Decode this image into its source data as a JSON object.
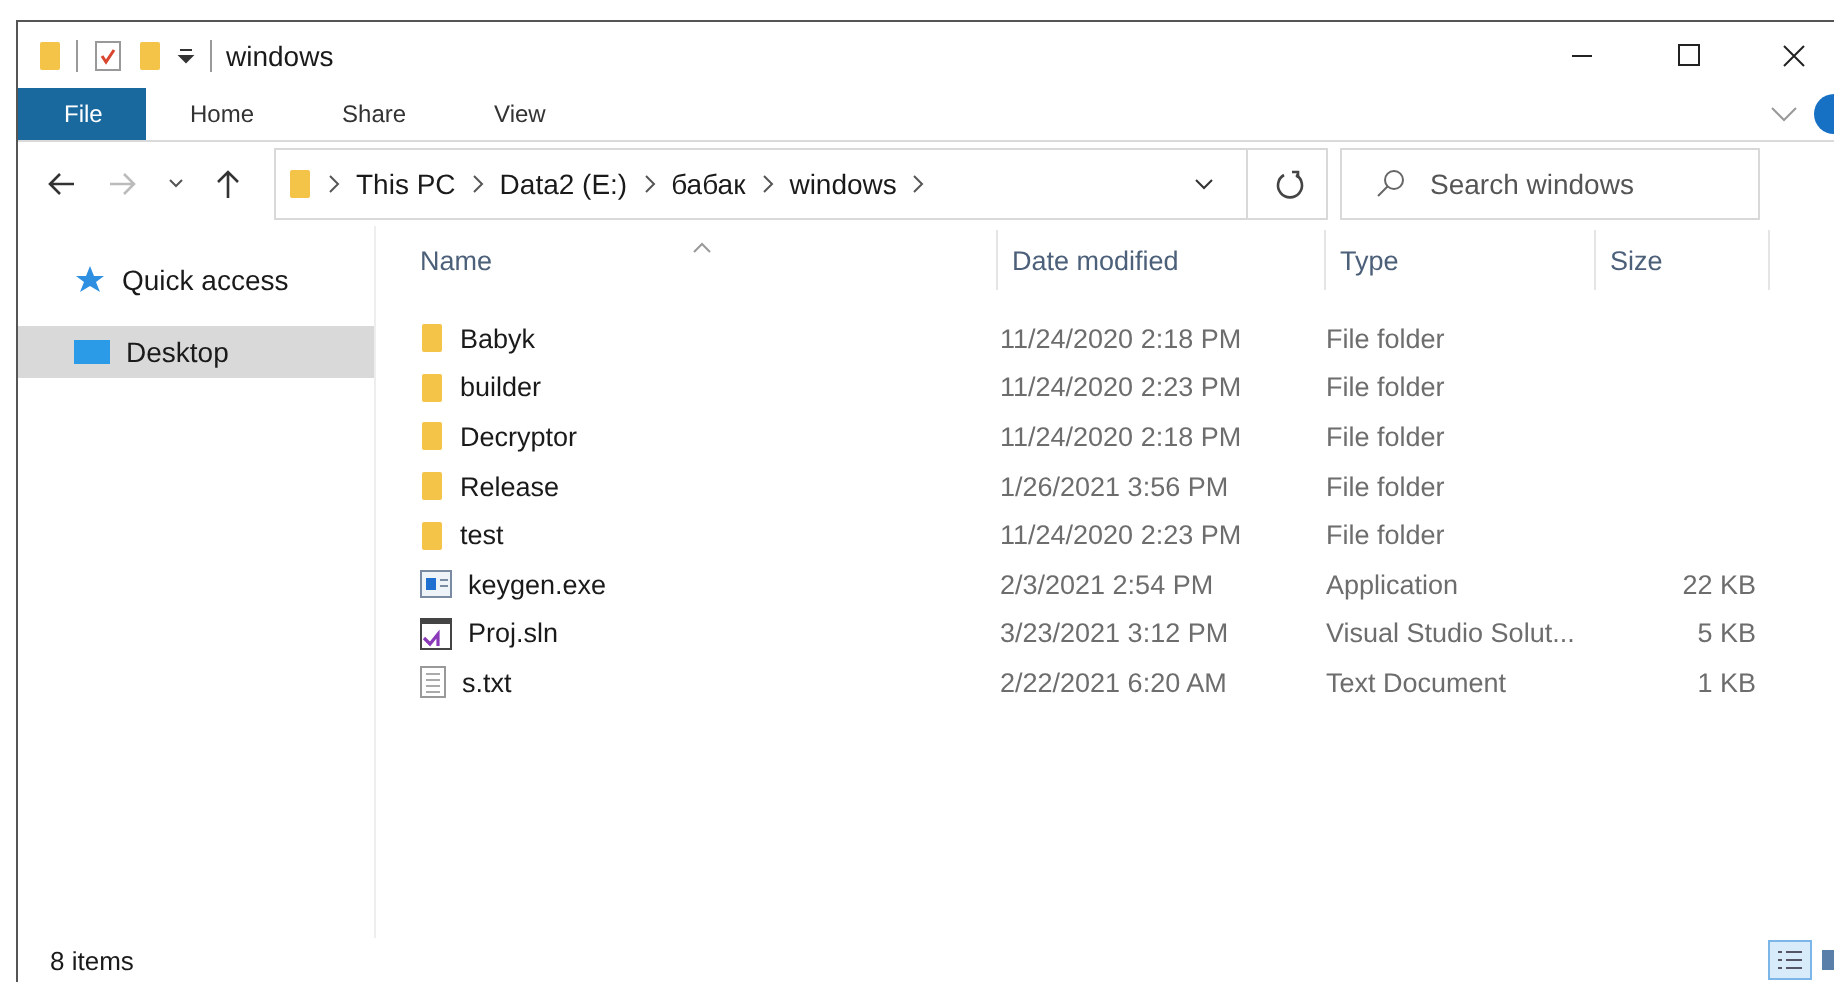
{
  "window": {
    "title": "windows"
  },
  "ribbon_tabs": [
    {
      "label": "File",
      "kind": "backstage",
      "selected": false
    },
    {
      "label": "Home",
      "kind": "tab",
      "selected": false
    },
    {
      "label": "Share",
      "kind": "tab",
      "selected": false
    },
    {
      "label": "View",
      "kind": "tab",
      "selected": false
    }
  ],
  "breadcrumb": [
    "This PC",
    "Data2 (E:)",
    "бабак",
    "windows"
  ],
  "search": {
    "placeholder": "Search windows"
  },
  "sidebar": {
    "items": [
      {
        "label": "Quick access",
        "kind": "star",
        "selected": false
      },
      {
        "label": "Desktop",
        "kind": "desktop",
        "selected": true
      }
    ]
  },
  "table": {
    "columns": [
      "Name",
      "Date modified",
      "Type",
      "Size"
    ],
    "rows": [
      {
        "name": "Babyk",
        "date": "11/24/2020 2:18 PM",
        "type": "File folder",
        "kind": "folder"
      },
      {
        "name": "builder",
        "date": "11/24/2020 2:23 PM",
        "type": "File folder",
        "kind": "folder"
      },
      {
        "name": "Decryptor",
        "date": "11/24/2020 2:18 PM",
        "type": "File folder",
        "kind": "folder"
      },
      {
        "name": "Release",
        "date": "1/26/2021 3:56 PM",
        "type": "File folder",
        "kind": "folder"
      },
      {
        "name": "test",
        "date": "11/24/2020 2:23 PM",
        "type": "File folder",
        "kind": "folder"
      },
      {
        "name": "keygen.exe",
        "date": "2/3/2021 2:54 PM",
        "type": "Application",
        "size": "22 KB",
        "kind": "exe"
      },
      {
        "name": "Proj.sln",
        "date": "3/23/2021 3:12 PM",
        "type": "Visual Studio Solut...",
        "size": "5 KB",
        "kind": "sln"
      },
      {
        "name": "s.txt",
        "date": "2/22/2021 6:20 AM",
        "type": "Text Document",
        "size": "1 KB",
        "kind": "txt"
      }
    ]
  },
  "status_bar": {
    "count": "8 items"
  },
  "view_buttons": [
    {
      "kind": "details",
      "selected": true
    },
    {
      "kind": "large-icons",
      "selected": false
    }
  ]
}
